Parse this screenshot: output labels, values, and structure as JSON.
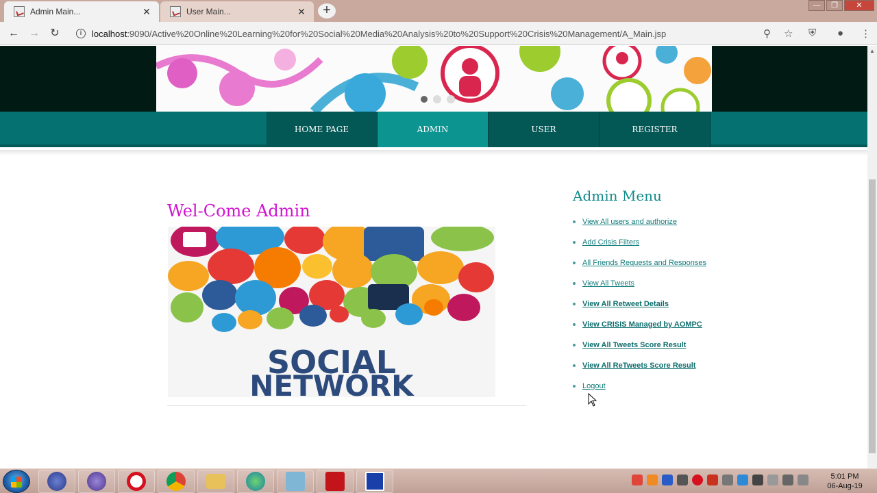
{
  "browser": {
    "tabs": [
      {
        "title": "Admin Main...",
        "active": true
      },
      {
        "title": "User Main...",
        "active": false
      }
    ],
    "url_host": "localhost",
    "url_rest": ":9090/Active%20Online%20Learning%20for%20Social%20Media%20Analysis%20to%20Support%20Crisis%20Management/A_Main.jsp"
  },
  "nav": {
    "items": [
      {
        "label": "HOME PAGE",
        "active": false
      },
      {
        "label": "ADMIN",
        "active": true
      },
      {
        "label": "USER",
        "active": false
      },
      {
        "label": "REGISTER",
        "active": false
      }
    ]
  },
  "main": {
    "welcome": "Wel-Come Admin",
    "image_text_line1": "SOCIAL",
    "image_text_line2": "NETWORK"
  },
  "menu": {
    "title": "Admin Menu",
    "items": [
      {
        "label": "View All users and authorize",
        "bold": false
      },
      {
        "label": "Add Crisis Filters",
        "bold": false
      },
      {
        "label": "All Friends Requests and Responses",
        "bold": false
      },
      {
        "label": "View All Tweets",
        "bold": false
      },
      {
        "label": "View All Retweet Details",
        "bold": true
      },
      {
        "label": "View CRISIS Managed by AOMPC",
        "bold": true
      },
      {
        "label": "View All Tweets Score Result",
        "bold": true
      },
      {
        "label": "View All ReTweets Score Result",
        "bold": true
      },
      {
        "label": "Logout",
        "bold": true
      }
    ]
  },
  "taskbar": {
    "time": "5:01 PM",
    "date": "06-Aug-19"
  },
  "colors": {
    "nav_bg": "#057271",
    "nav_active": "#0b9490",
    "welcome": "#d113d1",
    "menu_title": "#118b8b"
  },
  "icons": [
    "back-icon",
    "forward-icon",
    "reload-icon",
    "info-icon",
    "zoom-icon",
    "star-icon",
    "extension-icon",
    "profile-icon",
    "menu-icon",
    "close-icon",
    "new-tab-icon",
    "mouse-cursor-icon"
  ]
}
